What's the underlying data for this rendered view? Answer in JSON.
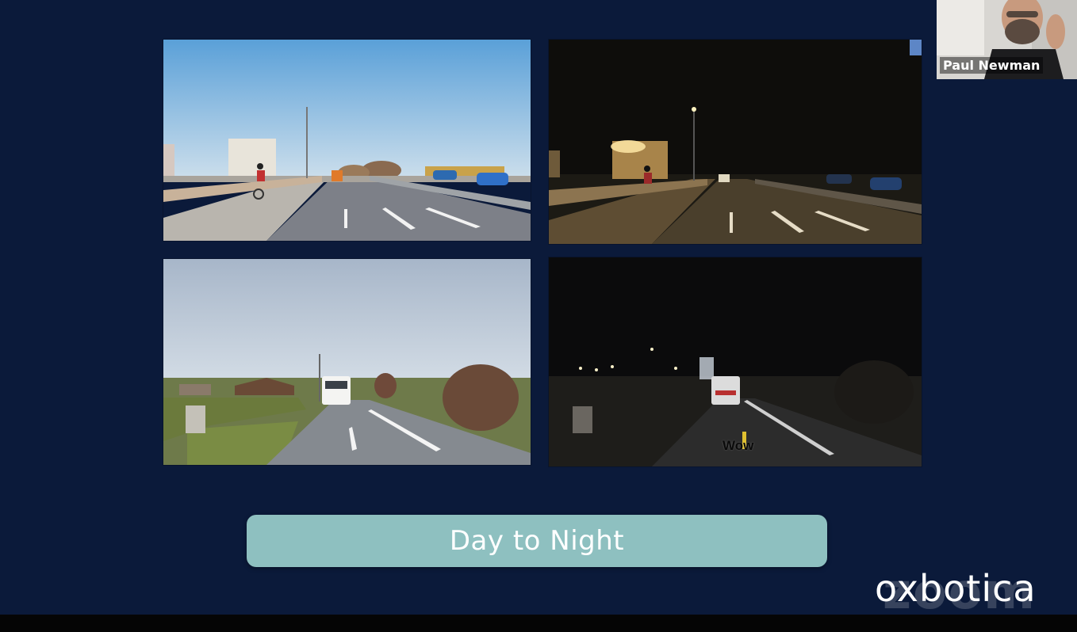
{
  "slide": {
    "caption": "Day to Night",
    "overlay_word": "Wow",
    "logo_text": "oxbotica",
    "watermark_text": "zoom",
    "colors": {
      "background": "#0b1a3a",
      "caption_pill": "#8ec0c0",
      "caption_text": "#ffffff"
    },
    "panels": [
      {
        "id": "highway-day",
        "scene": "day"
      },
      {
        "id": "highway-night",
        "scene": "night"
      },
      {
        "id": "rural-road-day",
        "scene": "day"
      },
      {
        "id": "rural-road-night",
        "scene": "night"
      }
    ]
  },
  "participant": {
    "name": "Paul Newman"
  }
}
